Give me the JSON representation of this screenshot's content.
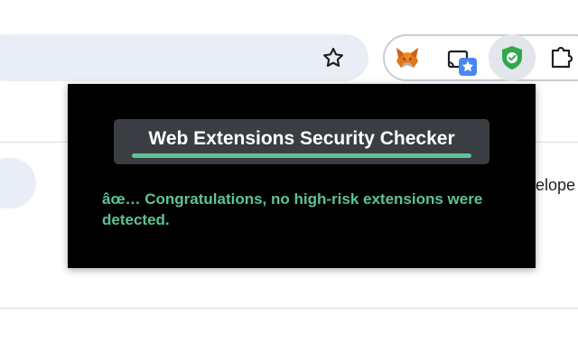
{
  "toolbar": {
    "bookmark_icon": "star-outline-icon",
    "extensions": [
      {
        "name": "fox-extension-icon"
      },
      {
        "name": "cast-badge-extension-icon"
      },
      {
        "name": "shield-check-extension-icon"
      },
      {
        "name": "puzzle-icon"
      }
    ]
  },
  "background_page": {
    "partial_text": "velope"
  },
  "popup": {
    "title": "Web Extensions Security Checker",
    "message": "âœ… Congratulations, no high-risk extensions were detected."
  },
  "colors": {
    "popup_bg": "#000000",
    "title_bg": "#3a3d42",
    "accent_green": "#5ec296",
    "address_bar_bg": "#e9eef6",
    "badge_blue": "#4a86f0"
  }
}
